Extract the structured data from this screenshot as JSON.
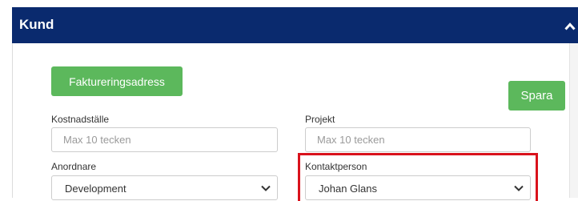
{
  "header": {
    "title": "Kund"
  },
  "buttons": {
    "fakturering": "Faktureringsadress",
    "spara": "Spara"
  },
  "fields": {
    "kostnadstalle": {
      "label": "Kostnadställe",
      "placeholder": "Max 10 tecken"
    },
    "projekt": {
      "label": "Projekt",
      "placeholder": "Max 10 tecken"
    },
    "anordnare": {
      "label": "Anordnare",
      "value": "Development"
    },
    "kontaktperson": {
      "label": "Kontaktperson",
      "value": "Johan Glans"
    }
  },
  "colors": {
    "header_bg": "#0a2a6e",
    "button_green": "#5cb85c",
    "highlight_red": "#d9121c"
  },
  "icons": {
    "collapse": "chevron-up-icon",
    "select": "chevron-down-icon"
  }
}
